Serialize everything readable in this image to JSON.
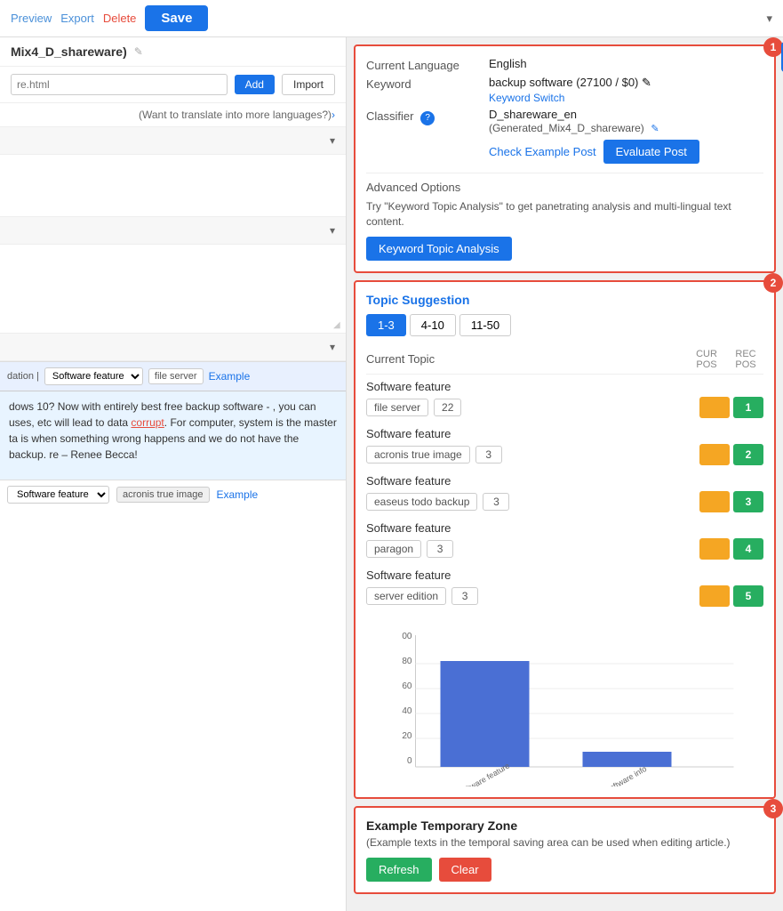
{
  "toolbar": {
    "preview_label": "Preview",
    "export_label": "Export",
    "delete_label": "Delete",
    "save_label": "Save",
    "chevron": "▾"
  },
  "left": {
    "title": "Mix4_D_shareware)",
    "file_placeholder": "re.html",
    "add_label": "Add",
    "import_label": "Import",
    "translate_text": "(Want to translate into more languages?)",
    "translate_arrow": "›",
    "sections": [
      {
        "label": "",
        "chevron": "▾"
      },
      {
        "label": "",
        "chevron": "▾"
      },
      {
        "label": "",
        "chevron": "▾"
      }
    ],
    "bottom_topic1": {
      "prefix": "dation |",
      "select_value": "Software feature",
      "kw": "file server",
      "example_link": "Example"
    },
    "article_text": "dows 10? Now with entirely best free backup software - , you can uses, etc will lead to data corrupt. For computer, system is the master ta is when something wrong happens and we do not have the backup. re – Renee Becca!",
    "highlight_word": "corrupt",
    "bottom_topic2": {
      "select_value": "Software feature",
      "kw_tag": "acronis true image",
      "example_link": "Example"
    }
  },
  "panel1": {
    "badge": "1",
    "current_language_label": "Current Language",
    "current_language_value": "English",
    "keyword_label": "Keyword",
    "keyword_value": "backup software (27100 / $0)",
    "keyword_switch": "Keyword Switch",
    "classifier_label": "Classifier",
    "classifier_value": "D_shareware_en",
    "classifier_gen": "(Generated_Mix4_D_shareware)",
    "check_example_label": "Check Example Post",
    "evaluate_label": "Evaluate Post",
    "advanced_title": "Advanced Options",
    "advanced_desc": "Try \"Keyword Topic Analysis\" to get panetrating analysis and multi-lingual text content.",
    "kta_label": "Keyword Topic Analysis",
    "gear_icon": "⚙"
  },
  "panel2": {
    "badge": "2",
    "title": "Topic Suggestion",
    "tabs": [
      {
        "label": "1-3",
        "active": true
      },
      {
        "label": "4-10",
        "active": false
      },
      {
        "label": "11-50",
        "active": false
      }
    ],
    "current_topic_label": "Current Topic",
    "cur_pos_label": "CUR POS",
    "rec_pos_label": "REC POS",
    "topics": [
      {
        "category": "Software feature",
        "kw": "file server",
        "num": "22",
        "cur_pos": "",
        "rec_pos": "1",
        "cur_color": "orange",
        "rec_color": "green"
      },
      {
        "category": "Software feature",
        "kw": "acronis true image",
        "num": "3",
        "cur_pos": "",
        "rec_pos": "2",
        "cur_color": "orange",
        "rec_color": "green"
      },
      {
        "category": "Software feature",
        "kw": "easeus todo backup",
        "num": "3",
        "cur_pos": "",
        "rec_pos": "3",
        "cur_color": "orange",
        "rec_color": "green"
      },
      {
        "category": "Software feature",
        "kw": "paragon",
        "num": "3",
        "cur_pos": "",
        "rec_pos": "4",
        "cur_color": "orange",
        "rec_color": "green"
      },
      {
        "category": "Software feature",
        "kw": "server edition",
        "num": "3",
        "cur_pos": "",
        "rec_pos": "5",
        "cur_color": "orange",
        "rec_color": "green"
      }
    ],
    "chart": {
      "y_labels": [
        "00",
        "80",
        "60",
        "40",
        "20",
        "0"
      ],
      "bars": [
        {
          "label": "Software feature",
          "value": 85,
          "color": "#4a6fd4"
        },
        {
          "label": "Software info",
          "value": 12,
          "color": "#4a6fd4"
        }
      ]
    }
  },
  "panel3": {
    "badge": "3",
    "title": "Example Temporary Zone",
    "desc": "(Example texts in the temporal saving area can be used when editing article.)",
    "refresh_label": "Refresh",
    "clear_label": "Clear"
  }
}
